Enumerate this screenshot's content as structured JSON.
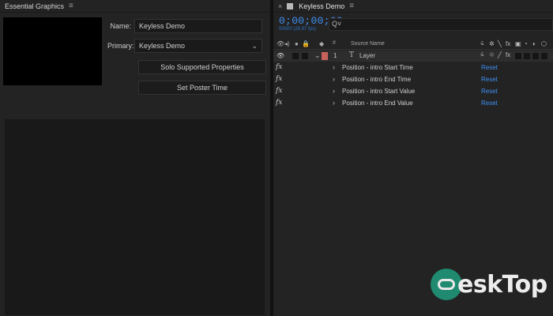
{
  "essential_graphics": {
    "title": "Essential Graphics",
    "menu_icon": "hamburger-icon",
    "name_label": "Name:",
    "name_value": "Keyless Demo",
    "primary_label": "Primary:",
    "primary_value": "Keyless Demo",
    "solo_button": "Solo Supported Properties",
    "poster_button": "Set Poster Time"
  },
  "timeline": {
    "tab_title": "Keyless Demo",
    "close_glyph": "×",
    "menu_glyph": "≡",
    "timecode": "0;00;00;00",
    "fps": "00000 (29.97 fps)",
    "search_glyph": "Q˅",
    "column_source": "Source Name",
    "column_num": "#",
    "layer": {
      "number": "1",
      "type_glyph": "T",
      "name": "Layer"
    },
    "properties": [
      {
        "fx": "fx",
        "name": "Position - intro Start Time",
        "reset": "Reset"
      },
      {
        "fx": "fx",
        "name": "Position - intro End Time",
        "reset": "Reset"
      },
      {
        "fx": "fx",
        "name": "Position - intro Start Value",
        "reset": "Reset"
      },
      {
        "fx": "fx",
        "name": "Position - intro End Value",
        "reset": "Reset"
      }
    ]
  },
  "watermark": {
    "text": "esk",
    "text2": "Top"
  },
  "colors": {
    "accent_blue": "#3f8ef0",
    "label_red": "#c6625c",
    "watermark_green": "#1f8a70"
  }
}
